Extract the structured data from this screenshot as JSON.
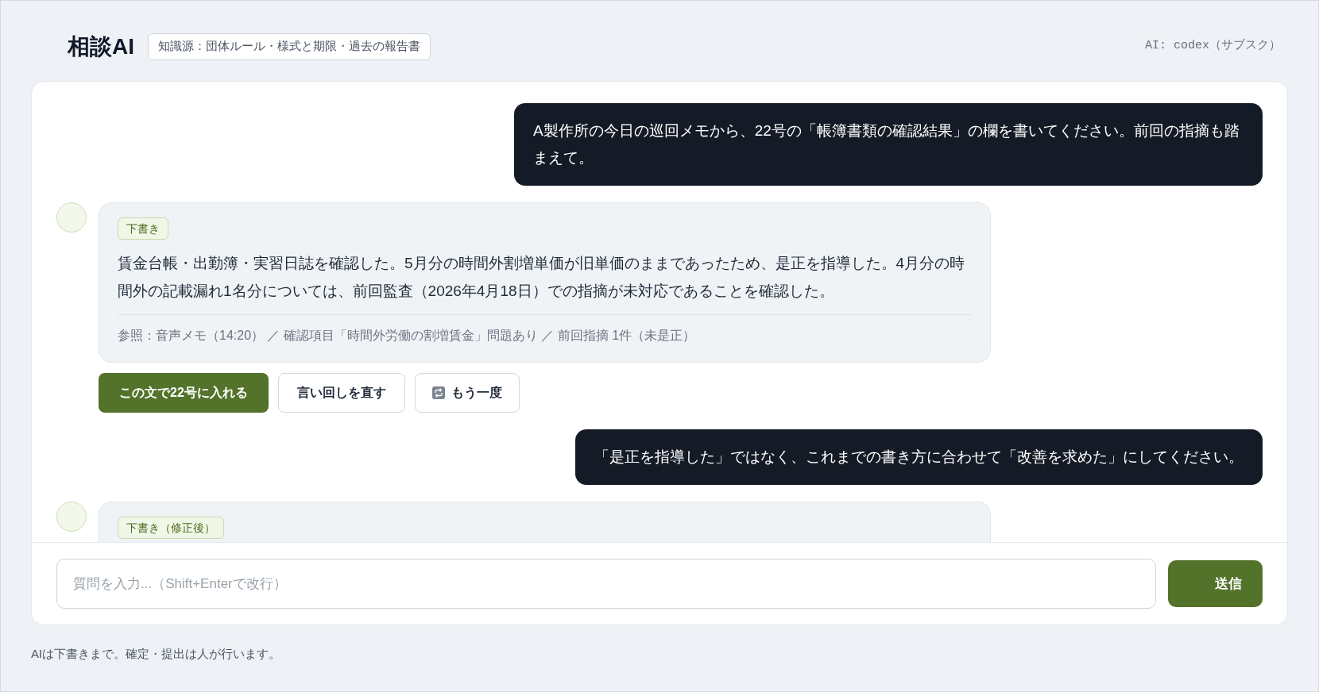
{
  "header": {
    "title": "相談AI",
    "knowledge_source": "知識源：団体ルール・様式と期限・過去の報告書",
    "model": "AI: codex（サブスク）"
  },
  "messages": [
    {
      "kind": "user",
      "text": "A製作所の今日の巡回メモから、22号の「帳簿書類の確認結果」の欄を書いてください。前回の指摘も踏まえて。"
    },
    {
      "kind": "assistant",
      "badge": "下書き",
      "text": "賃金台帳・出勤簿・実習日誌を確認した。5月分の時間外割増単価が旧単価のままであったため、是正を指導した。4月分の時間外の記載漏れ1名分については、前回監査（2026年4月18日）での指摘が未対応であることを確認した。",
      "reference": "参照：音声メモ（14:20） ／ 確認項目「時間外労働の割増賃金」問題あり ／ 前回指摘 1件（未是正）",
      "actions": [
        {
          "kind": "primary",
          "label": "この文で22号に入れる"
        },
        {
          "kind": "secondary",
          "label": "言い回しを直す"
        },
        {
          "kind": "retry",
          "label": "もう一度"
        }
      ]
    },
    {
      "kind": "user",
      "text": "「是正を指導した」ではなく、これまでの書き方に合わせて「改善を求めた」にしてください。"
    },
    {
      "kind": "assistant",
      "badge": "下書き（修正後）"
    }
  ],
  "composer": {
    "placeholder": "質問を入力...（Shift+Enterで改行）",
    "send_button": "送信"
  },
  "footer_note": "AIは下書きまで。確定・提出は人が行います。"
}
